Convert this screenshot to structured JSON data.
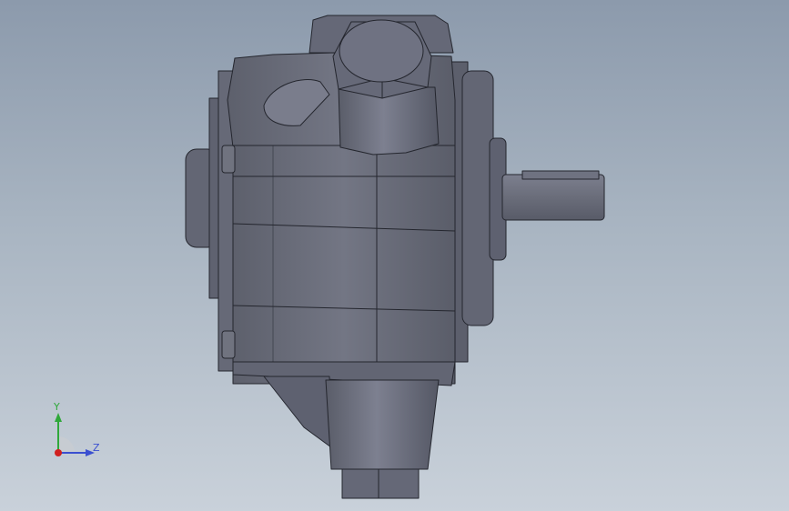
{
  "viewport": {
    "background_top": "#8c9aac",
    "background_bottom": "#c9d1da",
    "model": {
      "name": "gear-pump-3d-model",
      "body_color": "#6b6e7b",
      "edge_color": "#24262e"
    }
  },
  "triad": {
    "y_label": "Y",
    "z_label": "Z",
    "y_color": "#2fa83a",
    "z_color": "#3a4fd0",
    "x_color": "#d02020"
  }
}
